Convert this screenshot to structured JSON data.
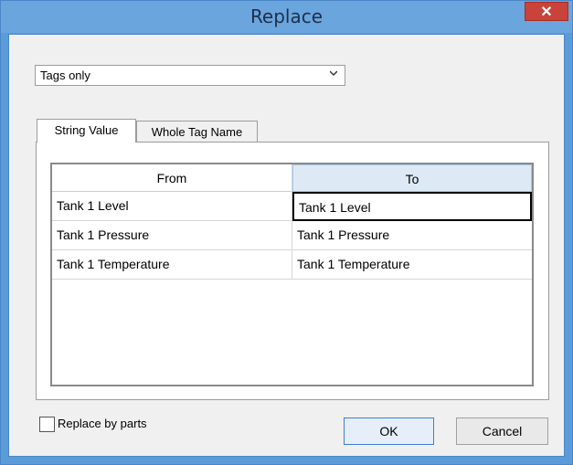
{
  "window": {
    "title": "Replace",
    "close_glyph": "✕"
  },
  "scope_dropdown": {
    "selected": "Tags only",
    "icon": "chevron-down-icon"
  },
  "tabs": [
    {
      "label": "String Value",
      "active": true
    },
    {
      "label": "Whole Tag Name",
      "active": false
    }
  ],
  "grid": {
    "headers": {
      "from": "From",
      "to": "To"
    },
    "rows": [
      {
        "from": "Tank 1 Level",
        "to": "Tank 1 Level"
      },
      {
        "from": "Tank 1 Pressure",
        "to": "Tank 1 Pressure"
      },
      {
        "from": "Tank 1 Temperature",
        "to": "Tank 1 Temperature"
      }
    ]
  },
  "replace_by_parts": {
    "label": "Replace by parts",
    "checked": false
  },
  "buttons": {
    "ok": "OK",
    "cancel": "Cancel"
  },
  "colors": {
    "title_bar": "#6aa5de",
    "close_button": "#c9433a",
    "dialog_bg": "#f0f0f0",
    "selected_header": "#ddeaf6"
  }
}
